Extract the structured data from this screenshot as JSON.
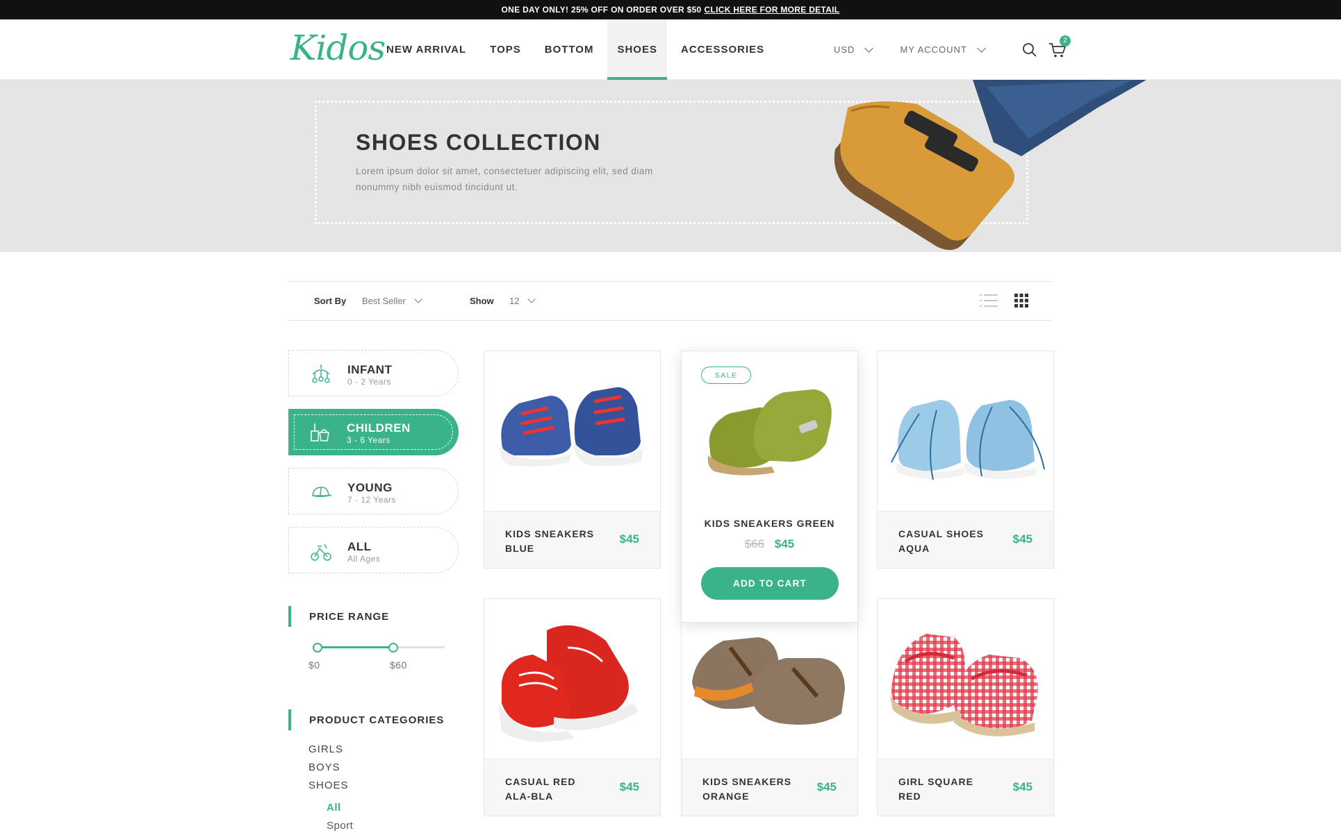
{
  "promo": {
    "text": "ONE DAY ONLY!  25% OFF ON ORDER OVER $50",
    "link": "CLICK HERE FOR MORE DETAIL"
  },
  "header": {
    "logo": "Kidos",
    "nav": [
      "NEW ARRIVAL",
      "TOPS",
      "BOTTOM",
      "SHOES",
      "ACCESSORIES"
    ],
    "active_nav": "SHOES",
    "currency": "USD",
    "account": "MY ACCOUNT",
    "cart_count": "2",
    "search_icon": "search-icon",
    "cart_icon": "cart-icon"
  },
  "hero": {
    "title": "SHOES COLLECTION",
    "text": "Lorem ipsum dolor sit amet, consectetuer adipiscing elit, sed diam nonummy nibh euismod tincidunt ut."
  },
  "toolbar": {
    "sort_label": "Sort By",
    "sort_value": "Best Seller",
    "show_label": "Show",
    "show_value": "12",
    "list_icon": "list-view-icon",
    "grid_icon": "grid-view-icon"
  },
  "sidebar": {
    "ages": [
      {
        "name": "INFANT",
        "range": "0 - 2 Years",
        "icon": "baby-mobile-icon"
      },
      {
        "name": "CHILDREN",
        "range": "3 - 6 Years",
        "icon": "bucket-icon"
      },
      {
        "name": "YOUNG",
        "range": "7 - 12 Years",
        "icon": "cap-icon"
      },
      {
        "name": "ALL",
        "range": "All Ages",
        "icon": "tricycle-icon"
      }
    ],
    "active_age": "CHILDREN",
    "price_title": "PRICE RANGE",
    "price_min": "$0",
    "price_max": "$60",
    "price_range_fraction": [
      0,
      0.62
    ],
    "categories_title": "PRODUCT CATEGORIES",
    "categories": [
      "GIRLS",
      "BOYS",
      "SHOES"
    ],
    "subcategories": [
      "All",
      "Sport"
    ],
    "active_subcategory": "All"
  },
  "products": [
    {
      "name": "KIDS SNEAKERS BLUE",
      "price": "$45"
    },
    {
      "name": "KIDS SNEAKERS GREEN",
      "price": "$45",
      "old_price": "$66",
      "badge": "SALE",
      "cta": "ADD TO CART"
    },
    {
      "name": "CASUAL SHOES AQUA",
      "price": "$45"
    },
    {
      "name": "CASUAL RED ALA-BLA",
      "price": "$45"
    },
    {
      "name": "KIDS SNEAKERS ORANGE",
      "price": "$45"
    },
    {
      "name": "GIRL SQUARE RED",
      "price": "$45"
    }
  ],
  "colors": {
    "accent": "#3bb38a",
    "promo_bg": "#111111",
    "hero_bg": "#e5e5e5"
  }
}
